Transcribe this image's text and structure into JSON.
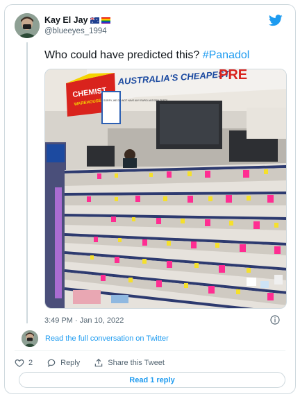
{
  "tweet": {
    "author_name": "Kay El Jay",
    "author_handle": "@blueeyes_1994",
    "text_main": "Who could have predicted this?",
    "hashtag": "#Panadol",
    "timestamp": "3:49 PM · Jan 10, 2022",
    "photo_texts": {
      "store_brand_line1": "CHEMIST",
      "store_brand_line2": "WAREHOUSE",
      "banner_text": "AUSTRALIA'S CHEAPEST",
      "banner_red_text": "PRE",
      "counter_sign": "SORRY, WE DO NOT HAVE ANY RAPID ANTIGEN TESTS"
    },
    "read_conversation": "Read the full conversation on Twitter",
    "like_count": "2",
    "reply_label": "Reply",
    "share_label": "Share this Tweet",
    "read_replies": "Read 1 reply"
  },
  "icons": {
    "brand": "twitter-bird-icon",
    "info": "info-icon",
    "like": "heart-icon",
    "reply": "speech-bubble-icon",
    "share": "share-icon"
  },
  "colors": {
    "accent": "#1d9bf0",
    "text": "#0f1419",
    "muted": "#536471",
    "border": "#cfd9de",
    "shelf_tag_pink": "#ff2d92",
    "shelf_tag_yellow": "#f5e02c",
    "store_red": "#d9231d"
  }
}
